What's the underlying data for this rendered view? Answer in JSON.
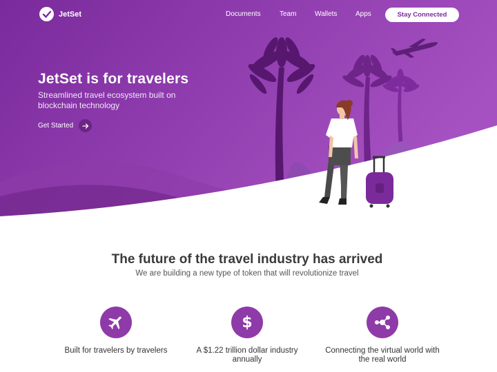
{
  "brand": {
    "name": "JetSet"
  },
  "nav": {
    "links": [
      "Documents",
      "Team",
      "Wallets",
      "Apps"
    ],
    "cta_label": "Stay Connected"
  },
  "hero": {
    "title": "JetSet is for travelers",
    "subtitle": "Streamlined travel ecosystem built on blockchain technology",
    "cta_label": "Get Started"
  },
  "section": {
    "title": "The future of the travel industry has arrived",
    "subtitle": "We are building a new type of token that will revolutionize travel"
  },
  "features": [
    {
      "icon": "airplane-icon",
      "label": "Built for travelers by travelers"
    },
    {
      "icon": "dollar-icon",
      "label": "A $1.22 trillion dollar industry annually"
    },
    {
      "icon": "network-icon",
      "label": "Connecting the virtual world with the real world"
    }
  ],
  "colors": {
    "hero_gradient_start": "#7b2a9e",
    "hero_gradient_end": "#a14fc0",
    "accent": "#8f3aa9",
    "button_text": "#7a2a9a"
  }
}
